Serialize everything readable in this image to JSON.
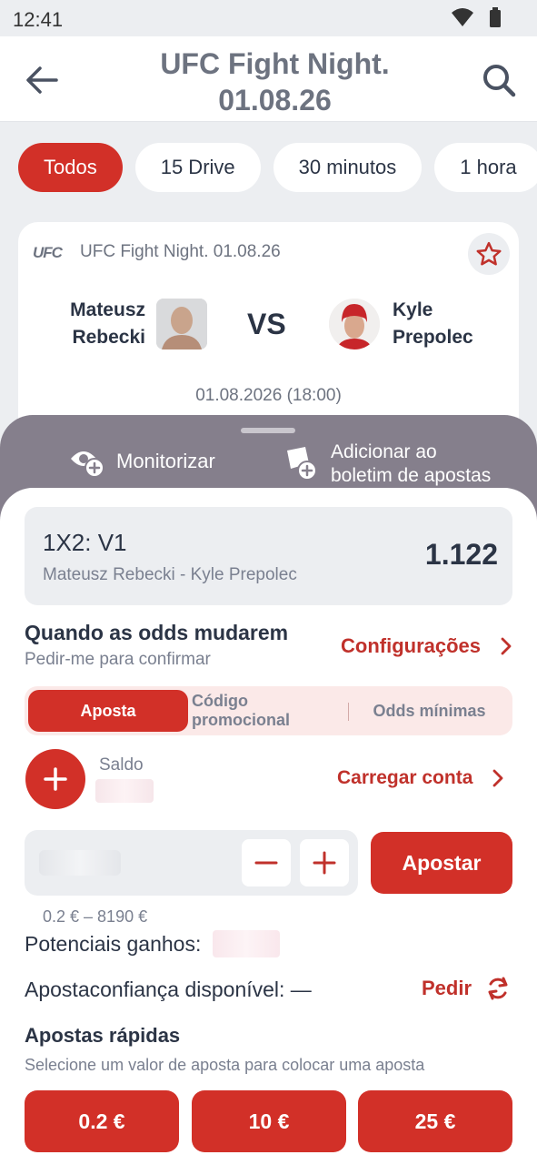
{
  "status_bar": {
    "time": "12:41"
  },
  "header": {
    "title_line1": "UFC Fight Night.",
    "title_line2": "01.08.26"
  },
  "filters": [
    "Todos",
    "15 Drive",
    "30 minutos",
    "1 hora"
  ],
  "event": {
    "logo": "UFC",
    "league": "UFC Fight Night. 01.08.26",
    "player1_line1": "Mateusz",
    "player1_line2": "Rebecki",
    "vs": "VS",
    "player2_line1": "Kyle",
    "player2_line2": "Prepolec",
    "date": "01.08.2026 (18:00)"
  },
  "actions": {
    "monitor": "Monitorizar",
    "add_line1": "Adicionar ao",
    "add_line2": "boletim de apostas"
  },
  "bet": {
    "market": "1X2: V1",
    "match": "Mateusz Rebecki - Kyle Prepolec",
    "odd": "1.122"
  },
  "odds_change": {
    "title": "Quando as odds mudarem",
    "subtitle": "Pedir-me para confirmar",
    "settings_label": "Configurações"
  },
  "tabs": [
    "Aposta",
    "Código promocional",
    "Odds mínimas"
  ],
  "balance": {
    "label": "Saldo",
    "load_label": "Carregar conta"
  },
  "stake": {
    "place_label": "Apostar",
    "range": "0.2 € – 8190 €"
  },
  "potential_label": "Potenciais ganhos:",
  "trust": {
    "label": "Apostaconfiança disponível: —",
    "ask_label": "Pedir"
  },
  "quick_bets": {
    "title": "Apostas rápidas",
    "subtitle": "Selecione um valor de aposta para colocar uma aposta",
    "amounts": [
      "0.2 €",
      "10 €",
      "25 €"
    ]
  },
  "colors": {
    "accent": "#d23028",
    "text_dark": "#2b3445",
    "text_muted": "#7a8090",
    "strip": "#857f8c"
  }
}
